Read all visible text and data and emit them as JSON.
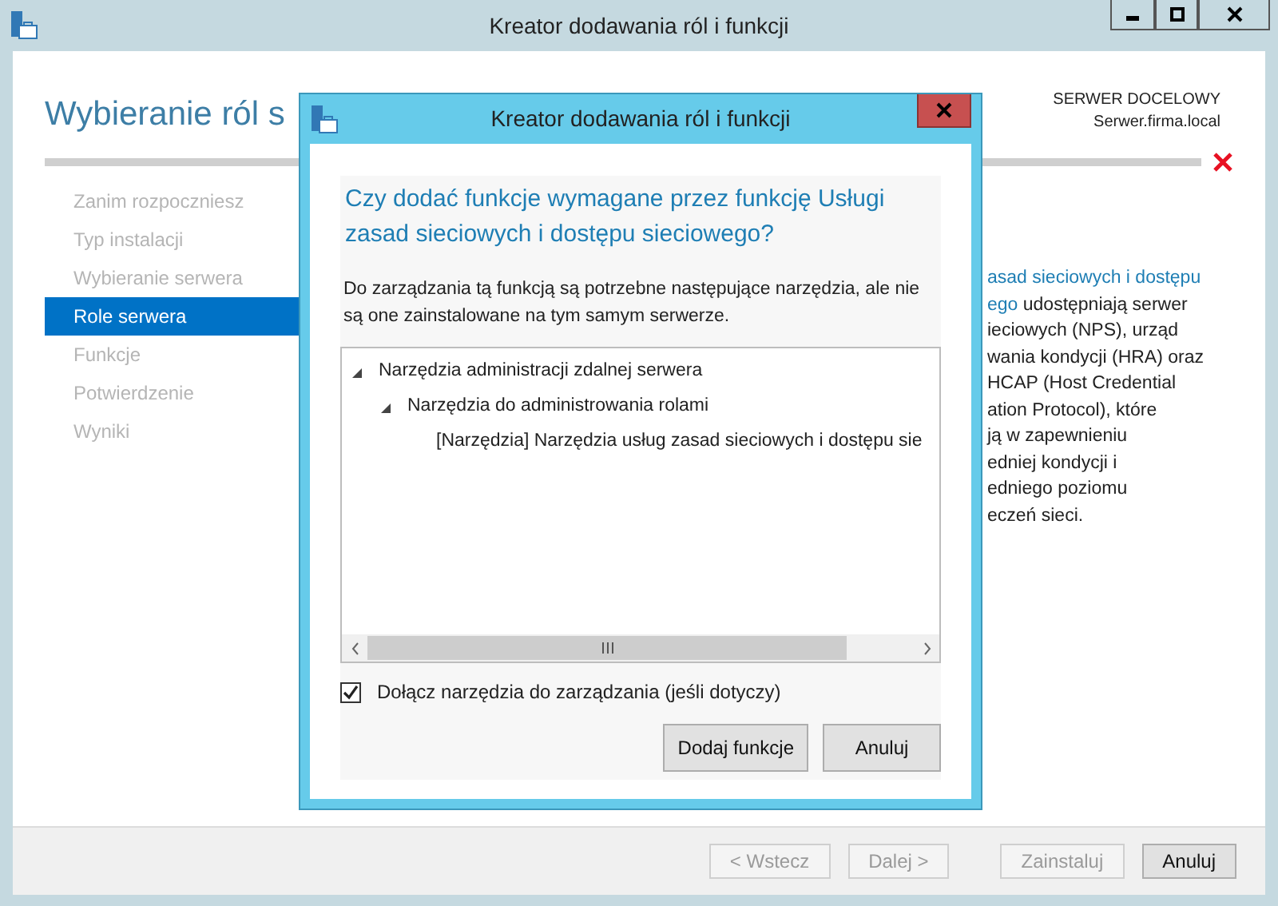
{
  "window": {
    "title": "Kreator dodawania ról i funkcji"
  },
  "page": {
    "heading": "Wybieranie ról s",
    "target_label": "SERWER DOCELOWY",
    "target_name": "Serwer.firma.local"
  },
  "steps": [
    {
      "label": "Zanim rozpoczniesz",
      "selected": false
    },
    {
      "label": "Typ instalacji",
      "selected": false
    },
    {
      "label": "Wybieranie serwera",
      "selected": false
    },
    {
      "label": "Role serwera",
      "selected": true
    },
    {
      "label": "Funkcje",
      "selected": false
    },
    {
      "label": "Potwierdzenie",
      "selected": false
    },
    {
      "label": "Wyniki",
      "selected": false
    }
  ],
  "description_lines": [
    {
      "link": "asad sieciowych i dostępu"
    },
    {
      "link": "ego",
      "text": " udostępniają serwer"
    },
    {
      "text": "ieciowych (NPS), urząd"
    },
    {
      "text": "wania kondycji (HRA) oraz"
    },
    {
      "text": "HCAP (Host Credential"
    },
    {
      "text": "ation Protocol), które"
    },
    {
      "text": "ją w zapewnieniu"
    },
    {
      "text": "edniej kondycji i"
    },
    {
      "text": "edniego poziomu"
    },
    {
      "text": "eczeń sieci."
    }
  ],
  "footer_buttons": [
    {
      "label": "< Wstecz",
      "disabled": true
    },
    {
      "label": "Dalej >",
      "disabled": true
    },
    {
      "label": "Zainstaluj",
      "disabled": true
    },
    {
      "label": "Anuluj",
      "disabled": false
    }
  ],
  "dialog": {
    "title": "Kreator dodawania ról i funkcji",
    "question": "Czy dodać funkcje wymagane przez funkcję Usługi zasad sieciowych i dostępu sieciowego?",
    "message": "Do zarządzania tą funkcją są potrzebne następujące narzędzia, ale nie są one zainstalowane na tym samym serwerze.",
    "tree": [
      {
        "label": "Narzędzia administracji zdalnej serwera",
        "expanded": true,
        "children": [
          {
            "label": "Narzędzia do administrowania rolami",
            "expanded": true,
            "children": [
              {
                "label": "[Narzędzia] Narzędzia usług zasad sieciowych i dostępu sie"
              }
            ]
          }
        ]
      }
    ],
    "checkbox": {
      "label": "Dołącz narzędzia do zarządzania (jeśli dotyczy)",
      "checked": true
    },
    "buttons": [
      "Dodaj funkcje",
      "Anuluj"
    ]
  }
}
